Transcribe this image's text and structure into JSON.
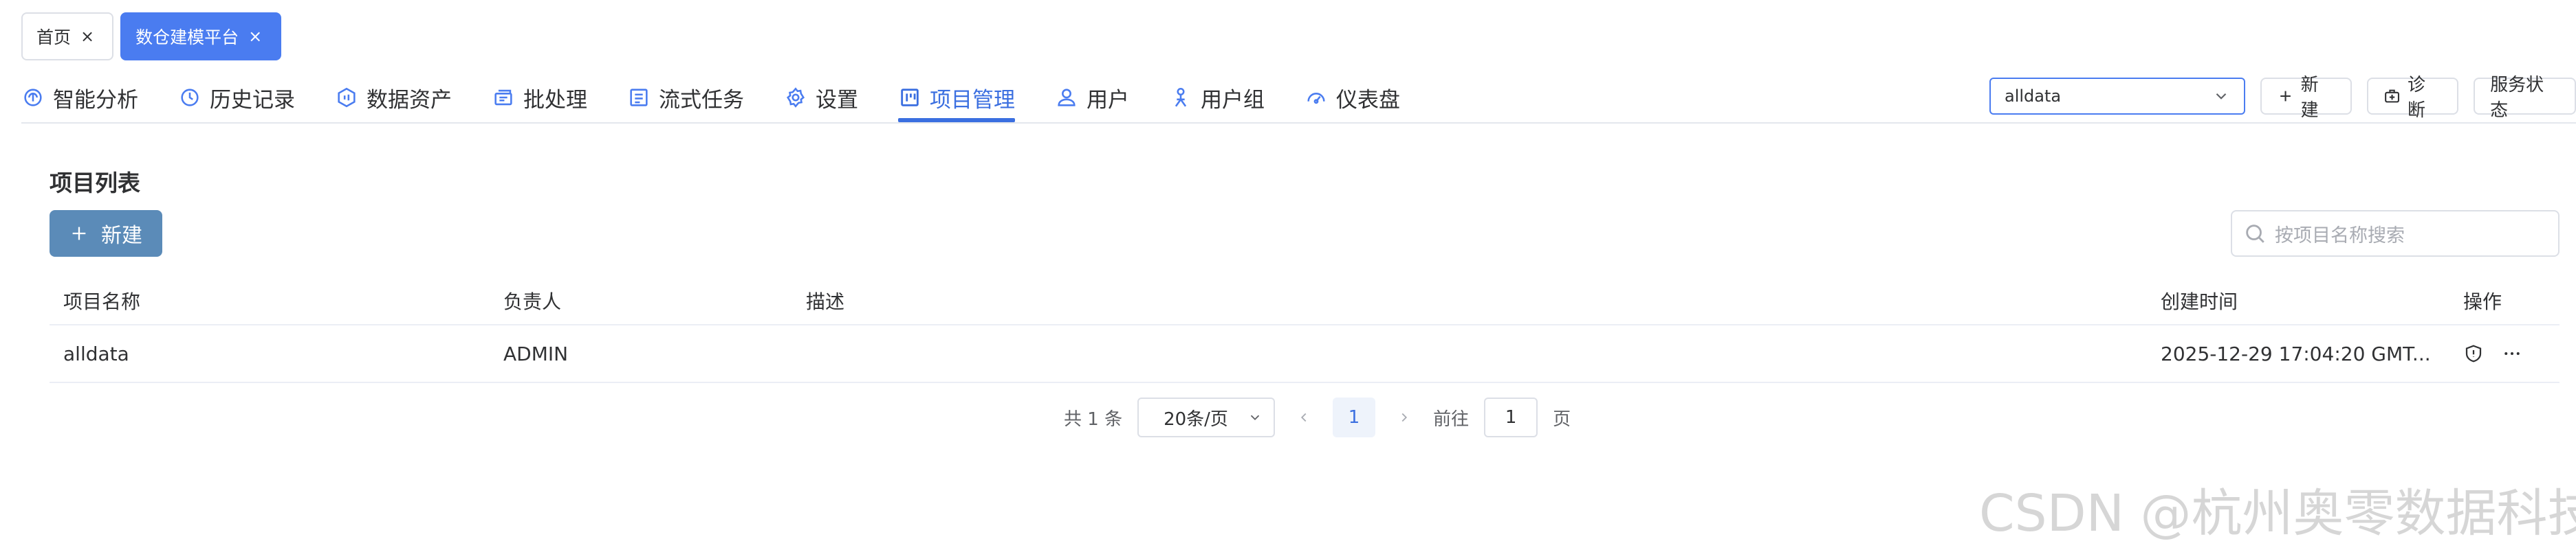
{
  "top_tabs": [
    {
      "label": "首页",
      "close": "×",
      "active": false
    },
    {
      "label": "数仓建模平台",
      "close": "×",
      "active": true
    }
  ],
  "nav": {
    "items": [
      {
        "label": "智能分析",
        "icon": "brain-icon"
      },
      {
        "label": "历史记录",
        "icon": "history-icon"
      },
      {
        "label": "数据资产",
        "icon": "data-asset-icon"
      },
      {
        "label": "批处理",
        "icon": "batch-icon"
      },
      {
        "label": "流式任务",
        "icon": "stream-task-icon"
      },
      {
        "label": "设置",
        "icon": "gear-icon"
      },
      {
        "label": "项目管理",
        "icon": "kanban-icon",
        "active": true
      },
      {
        "label": "用户",
        "icon": "user-icon"
      },
      {
        "label": "用户组",
        "icon": "user-group-icon"
      },
      {
        "label": "仪表盘",
        "icon": "dashboard-icon"
      }
    ],
    "project_select": "alldata",
    "new_label": "新建",
    "diagnose_label": "诊断",
    "service_status_label": "服务状态"
  },
  "main": {
    "section_title": "项目列表",
    "new_button_label": "新建",
    "search_placeholder": "按项目名称搜索",
    "columns": [
      "项目名称",
      "负责人",
      "描述",
      "创建时间",
      "操作"
    ],
    "rows": [
      {
        "name": "alldata",
        "owner": "ADMIN",
        "description": "",
        "created": "2025-12-29 17:04:20 GMT..."
      }
    ]
  },
  "pagination": {
    "total": "共 1 条",
    "page_size": "20条/页",
    "current_page": "1",
    "goto_label": "前往",
    "goto_value": "1",
    "page_unit": "页"
  },
  "watermark": "CSDN @杭州奥零数据科技",
  "colors": {
    "primary": "#3b6fe0",
    "new_button": "#5b8bb8",
    "active_tab": "#4a7cf0"
  }
}
